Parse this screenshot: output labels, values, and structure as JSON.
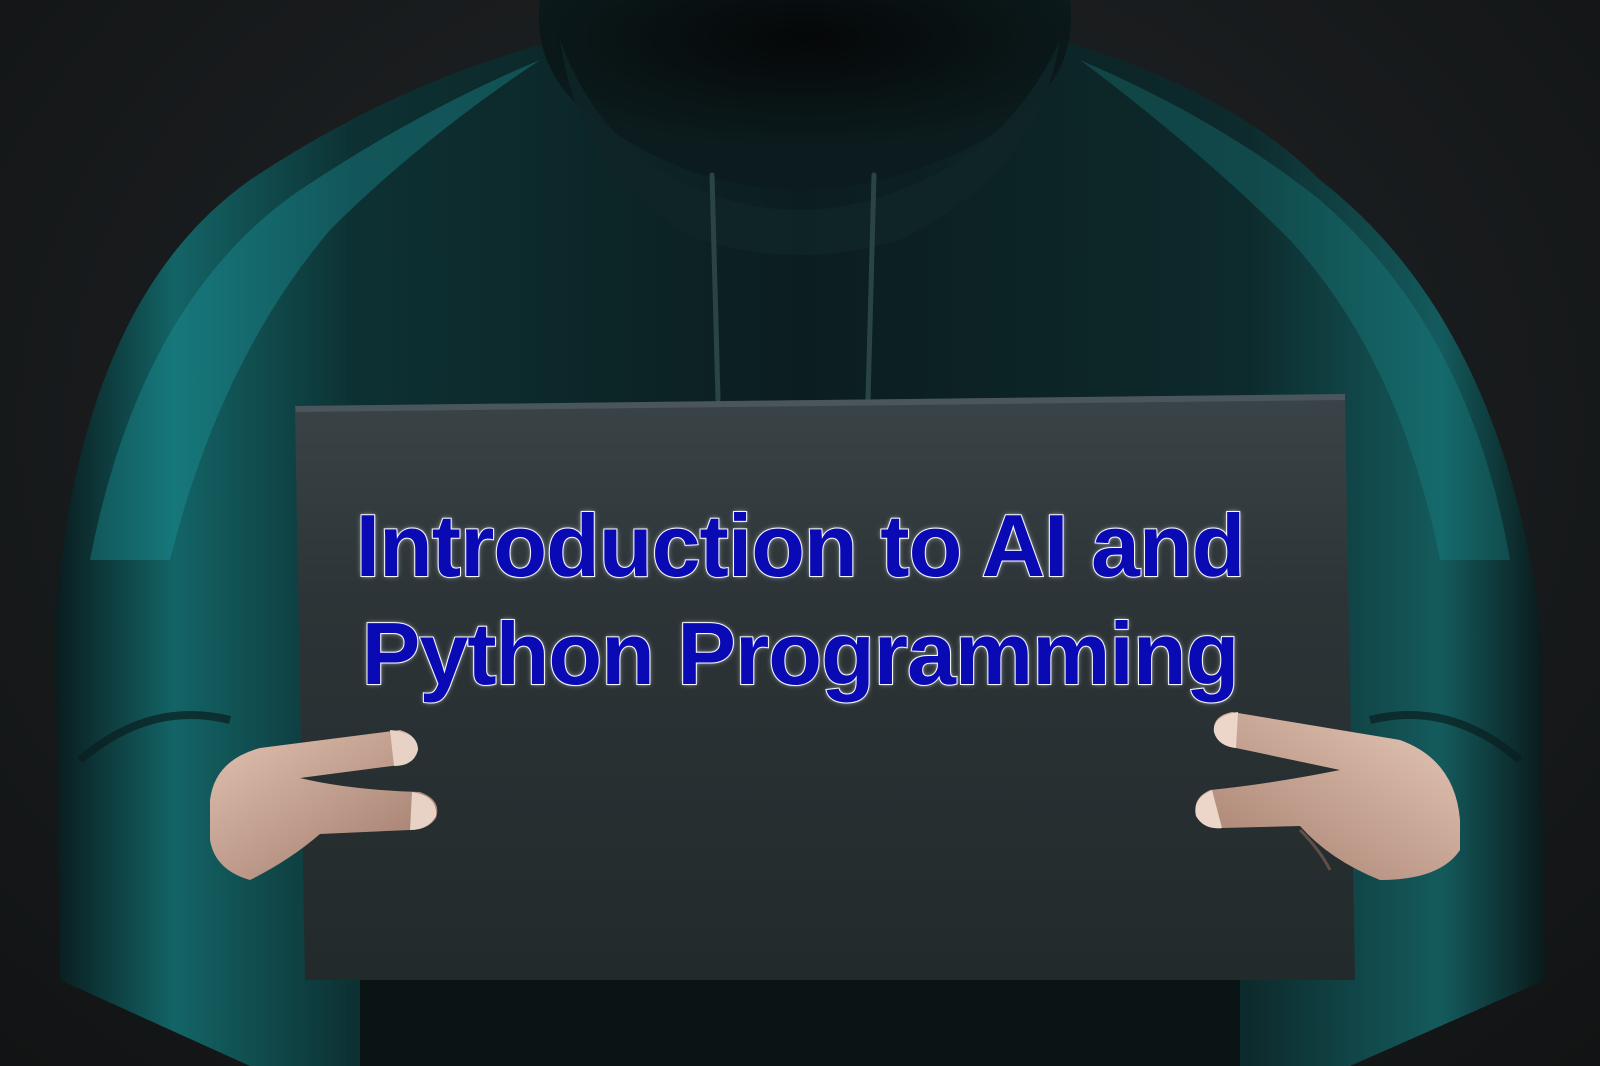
{
  "sign": {
    "line1": "Introduction to AI and",
    "line2": "Python Programming",
    "text_color": "#0a0ab4",
    "outline_color": "#f2f2ff"
  },
  "colors": {
    "background": "#1b1e20",
    "hoodie": "#0f2a2c",
    "rim_light": "#1fb5b8",
    "board": "#2c3437",
    "skin": "#c9a08c"
  }
}
